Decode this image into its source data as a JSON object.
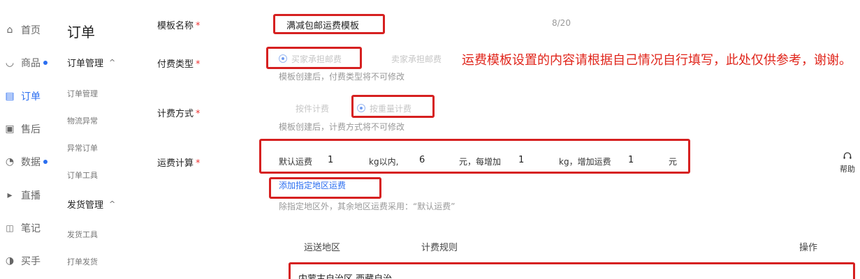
{
  "nav": {
    "items": [
      {
        "label": "首页",
        "icon": "home-icon",
        "glyph": "⌂",
        "dot": false,
        "active": false
      },
      {
        "label": "商品",
        "icon": "bag-icon",
        "glyph": "◡",
        "dot": true,
        "active": false
      },
      {
        "label": "订单",
        "icon": "order-icon",
        "glyph": "▤",
        "dot": false,
        "active": true
      },
      {
        "label": "售后",
        "icon": "aftersale-icon",
        "glyph": "▣",
        "dot": false,
        "active": false
      },
      {
        "label": "数据",
        "icon": "data-icon",
        "glyph": "◔",
        "dot": true,
        "active": false
      },
      {
        "label": "直播",
        "icon": "live-icon",
        "glyph": "▸",
        "dot": false,
        "active": false
      },
      {
        "label": "笔记",
        "icon": "notes-icon",
        "glyph": "📖",
        "dot": false,
        "active": false
      },
      {
        "label": "买手",
        "icon": "buyer-icon",
        "glyph": "◑",
        "dot": false,
        "active": false
      }
    ]
  },
  "subnav": {
    "title": "订单",
    "group1": "订单管理",
    "group1_links": [
      "订单管理",
      "物流异常",
      "异常订单",
      "订单工具"
    ],
    "group2": "发货管理",
    "group2_links": [
      "发货工具",
      "打单发货"
    ],
    "caret": "^"
  },
  "form": {
    "template_name_label": "模板名称",
    "template_name_value": "满减包邮运费模板",
    "template_name_count": "8/20",
    "pay_type_label": "付费类型",
    "pay_option_buyer": "买家承担邮费",
    "pay_option_seller": "卖家承担邮费",
    "pay_type_hint": "模板创建后，付费类型将不可修改",
    "calc_method_label": "计费方式",
    "calc_option_piece": "按件计费",
    "calc_option_weight": "按重量计费",
    "calc_method_hint": "模板创建后，计费方式将不可修改",
    "freight_label": "运费计算",
    "freight": {
      "default_label": "默认运费",
      "base_weight": "1",
      "unit_within": "kg以内,",
      "base_fee": "6",
      "unit_each_add": "元，每增加",
      "add_weight": "1",
      "unit_add_fee": "kg，增加运费",
      "add_fee": "1",
      "unit_yuan": "元"
    },
    "add_region_link": "添加指定地区运费",
    "region_hint": "除指定地区外，其余地区运费采用：“默认运费”",
    "required_mark": "*"
  },
  "table": {
    "col_region": "运送地区",
    "col_rule": "计费规则",
    "col_action": "操作",
    "rows": [
      {
        "region": "内蒙古自治区,西藏自治"
      }
    ]
  },
  "annotation": "运费模板设置的内容请根据自己情况自行填写，此处仅供参考，谢谢。",
  "help": {
    "label": "帮助",
    "icon": "headset-icon"
  },
  "colors": {
    "accent": "#2b6ef0",
    "annotation_red": "#e0251b",
    "box_red": "#d62020"
  }
}
